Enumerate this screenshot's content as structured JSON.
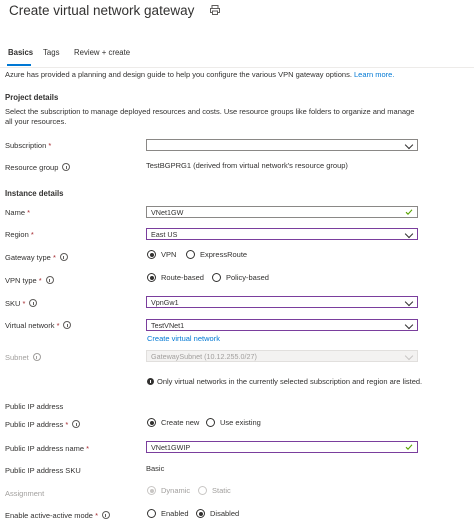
{
  "header": {
    "title": "Create virtual network gateway",
    "print_icon": "print-icon"
  },
  "tabs": [
    {
      "label": "Basics",
      "active": true
    },
    {
      "label": "Tags"
    },
    {
      "label": "Review + create"
    }
  ],
  "intro": {
    "text": "Azure has provided a planning and design guide to help you configure the various VPN gateway options.",
    "link": "Learn more."
  },
  "project": {
    "heading": "Project details",
    "description": "Select the subscription to manage deployed resources and costs. Use resource groups like folders to organize and manage all your resources.",
    "subscription": {
      "label": "Subscription",
      "value": ""
    },
    "resource_group": {
      "label": "Resource group",
      "value": "TestBGPRG1 (derived from virtual network's resource group)"
    }
  },
  "instance": {
    "heading": "Instance details",
    "name": {
      "label": "Name",
      "value": "VNet1GW"
    },
    "region": {
      "label": "Region",
      "value": "East US"
    },
    "gateway_type": {
      "label": "Gateway type",
      "options": [
        "VPN",
        "ExpressRoute"
      ],
      "selected": "VPN"
    },
    "vpn_type": {
      "label": "VPN type",
      "options": [
        "Route-based",
        "Policy-based"
      ],
      "selected": "Route-based"
    },
    "sku": {
      "label": "SKU",
      "value": "VpnGw1"
    },
    "virtual_network": {
      "label": "Virtual network",
      "value": "TestVNet1",
      "create_link": "Create virtual network"
    },
    "subnet": {
      "label": "Subnet",
      "value": "GatewaySubnet (10.12.255.0/27)"
    },
    "note": "Only virtual networks in the currently selected subscription and region are listed."
  },
  "public_ip": {
    "heading": "Public IP address",
    "address": {
      "label": "Public IP address",
      "options": [
        "Create new",
        "Use existing"
      ],
      "selected": "Create new"
    },
    "name": {
      "label": "Public IP address name",
      "value": "VNet1GWIP"
    },
    "sku": {
      "label": "Public IP address SKU",
      "value": "Basic"
    },
    "assignment": {
      "label": "Assignment",
      "options": [
        "Dynamic",
        "Static"
      ],
      "selected": "Dynamic"
    },
    "active_active": {
      "label": "Enable active-active mode",
      "options": [
        "Enabled",
        "Disabled"
      ],
      "selected": "Disabled"
    }
  },
  "colors": {
    "accent": "#0078d4",
    "focus_border": "#7a3e9d",
    "valid_check": "#57a300",
    "required": "#a4262c"
  }
}
